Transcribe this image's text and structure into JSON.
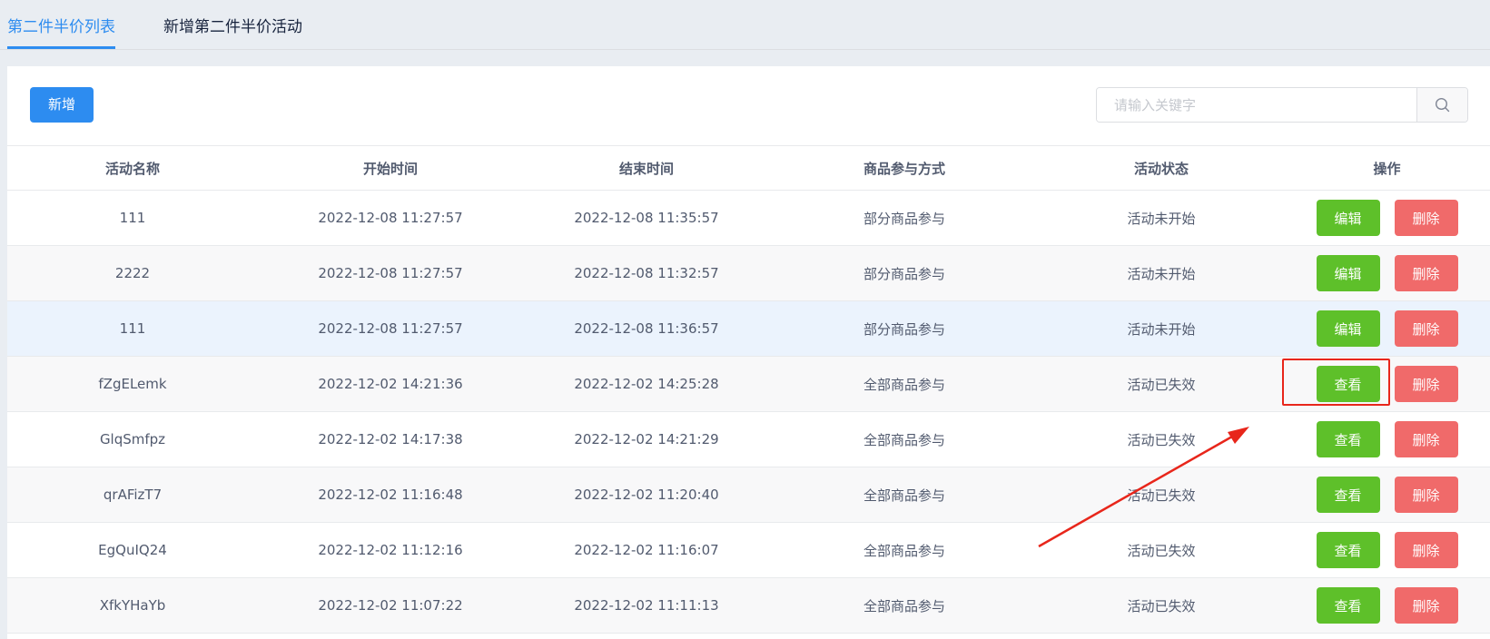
{
  "tabs": [
    {
      "label": "第二件半价列表",
      "active": true
    },
    {
      "label": "新增第二件半价活动",
      "active": false
    }
  ],
  "toolbar": {
    "add_label": "新增",
    "search_placeholder": "请输入关键字",
    "search_icon": "search-icon"
  },
  "table": {
    "headers": [
      "活动名称",
      "开始时间",
      "结束时间",
      "商品参与方式",
      "活动状态",
      "操作"
    ],
    "rows": [
      {
        "name": "111",
        "start": "2022-12-08 11:27:57",
        "end": "2022-12-08 11:35:57",
        "mode": "部分商品参与",
        "status": "活动未开始",
        "action": "编辑",
        "delete": "删除"
      },
      {
        "name": "2222",
        "start": "2022-12-08 11:27:57",
        "end": "2022-12-08 11:32:57",
        "mode": "部分商品参与",
        "status": "活动未开始",
        "action": "编辑",
        "delete": "删除"
      },
      {
        "name": "111",
        "start": "2022-12-08 11:27:57",
        "end": "2022-12-08 11:36:57",
        "mode": "部分商品参与",
        "status": "活动未开始",
        "action": "编辑",
        "delete": "删除"
      },
      {
        "name": "fZgELemk",
        "start": "2022-12-02 14:21:36",
        "end": "2022-12-02 14:25:28",
        "mode": "全部商品参与",
        "status": "活动已失效",
        "action": "查看",
        "delete": "删除"
      },
      {
        "name": "GlqSmfpz",
        "start": "2022-12-02 14:17:38",
        "end": "2022-12-02 14:21:29",
        "mode": "全部商品参与",
        "status": "活动已失效",
        "action": "查看",
        "delete": "删除"
      },
      {
        "name": "qrAFizT7",
        "start": "2022-12-02 11:16:48",
        "end": "2022-12-02 11:20:40",
        "mode": "全部商品参与",
        "status": "活动已失效",
        "action": "查看",
        "delete": "删除"
      },
      {
        "name": "EgQuIQ24",
        "start": "2022-12-02 11:12:16",
        "end": "2022-12-02 11:16:07",
        "mode": "全部商品参与",
        "status": "活动已失效",
        "action": "查看",
        "delete": "删除"
      },
      {
        "name": "XfkYHaYb",
        "start": "2022-12-02 11:07:22",
        "end": "2022-12-02 11:11:13",
        "mode": "全部商品参与",
        "status": "活动已失效",
        "action": "查看",
        "delete": "删除"
      }
    ]
  },
  "colors": {
    "accent": "#2d8cf0",
    "action_green": "#5ec02a",
    "delete_red": "#f06a6a",
    "annotation_red": "#e8261b"
  }
}
